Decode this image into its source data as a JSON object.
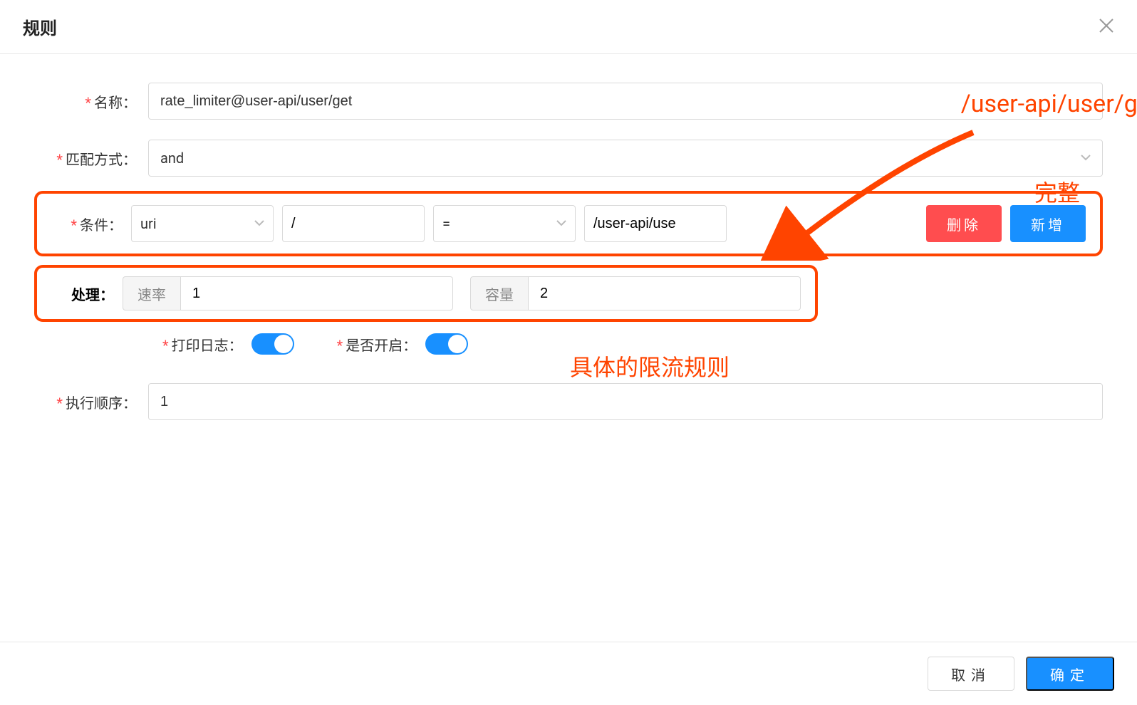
{
  "header": {
    "title": "规则"
  },
  "form": {
    "name_label": "名称：",
    "name_value": "rate_limiter@user-api/user/get",
    "match_label": "匹配方式：",
    "match_value": "and",
    "condition_label": "条件：",
    "condition_field": "uri",
    "condition_path": "/",
    "condition_op": "=",
    "condition_value": "/user-api/use",
    "delete_btn": "删除",
    "add_btn": "新增",
    "processing_label": "处理：",
    "rate_label": "速率",
    "rate_value": "1",
    "capacity_label": "容量",
    "capacity_value": "2",
    "log_label": "打印日志：",
    "enable_label": "是否开启：",
    "order_label": "执行顺序：",
    "order_value": "1"
  },
  "footer": {
    "cancel": "取消",
    "confirm": "确定"
  },
  "annotations": {
    "full_path": "/user-api/user/get",
    "complete": "完整",
    "rate_limit_desc": "具体的限流规则"
  }
}
